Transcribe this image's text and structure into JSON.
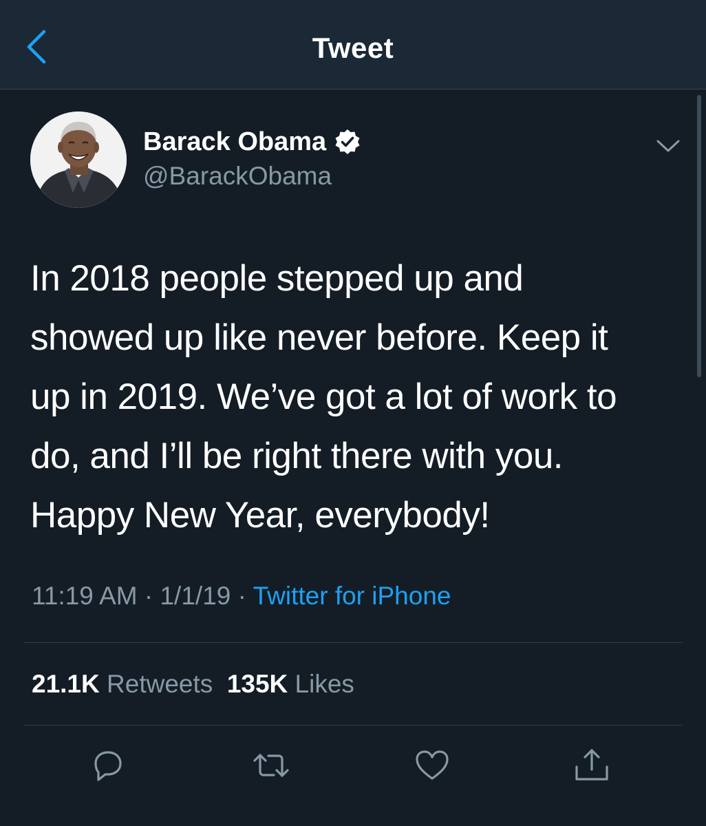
{
  "header": {
    "title": "Tweet",
    "back_icon": "chevron-left-icon"
  },
  "author": {
    "display_name": "Barack Obama",
    "handle": "@BarackObama",
    "verified": true,
    "avatar_icon": "avatar-photo"
  },
  "tweet": {
    "lines": [
      "In 2018 people stepped up and",
      "showed up like never before. Keep it",
      "up in 2019. We’ve got a lot of work to",
      "do, and I’ll be right there with you.",
      "Happy New Year, everybody!"
    ],
    "time": "11:19 AM",
    "date": "1/1/19",
    "source": "Twitter for iPhone"
  },
  "stats": {
    "retweets_count": "21.1K",
    "retweets_label": "Retweets",
    "likes_count": "135K",
    "likes_label": "Likes"
  },
  "actions": [
    "reply-icon",
    "retweet-icon",
    "like-icon",
    "share-icon"
  ],
  "colors": {
    "background": "#141d26",
    "header_background": "#1b2836",
    "accent": "#1da1f2",
    "secondary_text": "#8899a6"
  }
}
